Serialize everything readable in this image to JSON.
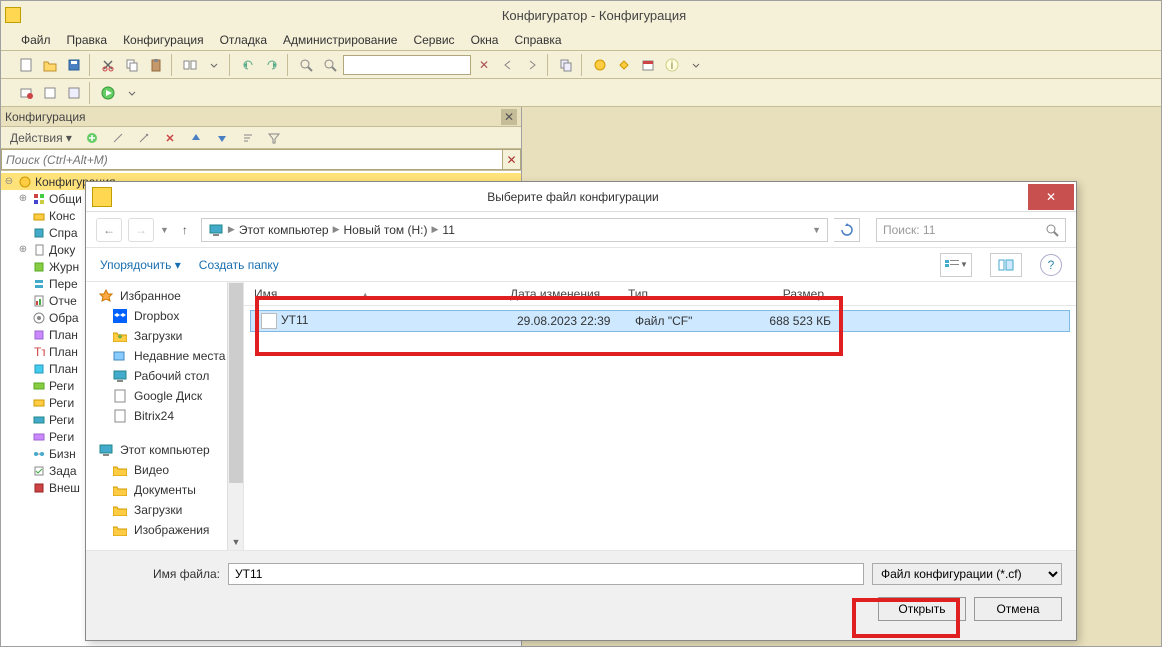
{
  "app": {
    "title": "Конфигуратор - Конфигурация"
  },
  "menubar": {
    "items": [
      "Файл",
      "Правка",
      "Конфигурация",
      "Отладка",
      "Администрирование",
      "Сервис",
      "Окна",
      "Справка"
    ]
  },
  "config_panel": {
    "title": "Конфигурация",
    "actions_label": "Действия",
    "search_placeholder": "Поиск (Ctrl+Alt+M)",
    "tree": {
      "root": "Конфигурация",
      "items": [
        "Общи",
        "Конс",
        "Спра",
        "Доку",
        "Журн",
        "Пере",
        "Отче",
        "Обра",
        "План",
        "План",
        "План",
        "Реги",
        "Реги",
        "Реги",
        "Реги",
        "Бизн",
        "Зада",
        "Внеш"
      ]
    }
  },
  "file_dialog": {
    "title": "Выберите файл конфигурации",
    "path": {
      "seg0": "Этот компьютер",
      "seg1": "Новый том (H:)",
      "seg2": "11"
    },
    "search_placeholder": "Поиск: 11",
    "toolbar": {
      "organize": "Упорядочить",
      "new_folder": "Создать папку"
    },
    "sidebar": {
      "favorites": "Избранное",
      "dropbox": "Dropbox",
      "downloads": "Загрузки",
      "recent": "Недавние места",
      "desktop": "Рабочий стол",
      "gdisk": "Google Диск",
      "bitrix": "Bitrix24",
      "computer": "Этот компьютер",
      "video": "Видео",
      "documents": "Документы",
      "downloads2": "Загрузки",
      "images": "Изображения"
    },
    "columns": {
      "name": "Имя",
      "date": "Дата изменения",
      "type": "Тип",
      "size": "Размер"
    },
    "file": {
      "name": "УТ11",
      "date": "29.08.2023 22:39",
      "type": "Файл \"CF\"",
      "size": "688 523 КБ"
    },
    "footer": {
      "filename_label": "Имя файла:",
      "filename_value": "УТ11",
      "filter": "Файл конфигурации (*.cf)",
      "open": "Открыть",
      "cancel": "Отмена"
    }
  }
}
